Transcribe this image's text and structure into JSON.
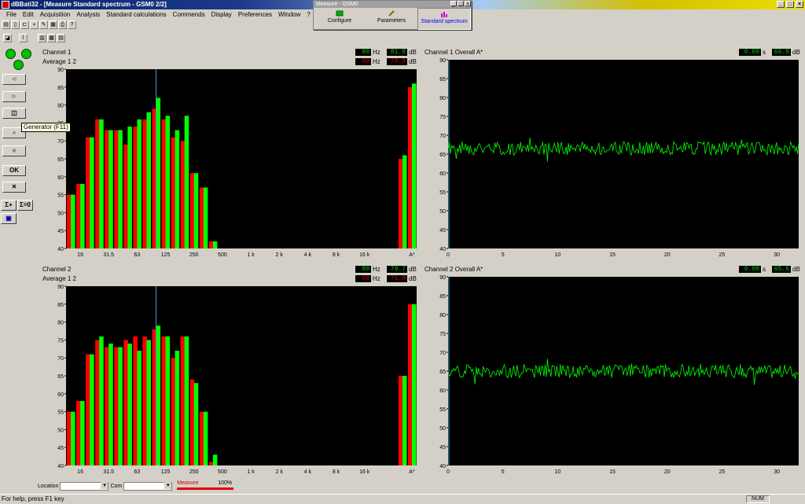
{
  "window": {
    "title": "dBBati32 - [Measure Standard spectrum - GSM0 2/2]"
  },
  "menu": [
    "File",
    "Edit",
    "Acquisition",
    "Analysis",
    "Standard calculations",
    "Commends",
    "Display",
    "Preferences",
    "Window",
    "?"
  ],
  "float_window": {
    "title": "Measure - GSM0",
    "buttons": [
      {
        "label": "Configure",
        "icon": "configure-icon"
      },
      {
        "label": "Parameters",
        "icon": "pencil-icon"
      },
      {
        "label": "Standard spectrum",
        "icon": "spectrum-icon"
      }
    ]
  },
  "left_toolbar": {
    "ok_label": "OK",
    "sigma_save_label": "Σ+",
    "sigma_zero_label": "Σ=0"
  },
  "tooltip": "Generator (F11)",
  "bottom": {
    "location_label": "Location",
    "com_label": "Com",
    "measure_label": "Measure",
    "measure_percent": "100%",
    "measure_progress": 1.0
  },
  "status": {
    "help": "For help, press F1 key",
    "num": "NUM"
  },
  "panels": [
    {
      "id": "ch1-spectrum",
      "title": "Channel 1",
      "subtitle": "Average 1 2",
      "readout1": {
        "value": "80",
        "unit": "Hz",
        "db": "81.8",
        "db_unit": "dB"
      },
      "readout2": {
        "value": "80",
        "unit": "Hz",
        "db": "78.8",
        "db_unit": "dB"
      }
    },
    {
      "id": "ch1-overall",
      "title": "Channel 1    Overall A*",
      "readout1": {
        "value": "0.00",
        "unit": "s",
        "db": "66.8",
        "db_unit": "dB"
      }
    },
    {
      "id": "ch2-spectrum",
      "title": "Channel 2",
      "subtitle": "Average 1 2",
      "readout1": {
        "value": "80",
        "unit": "Hz",
        "db": "79.7",
        "db_unit": "dB"
      },
      "readout2": {
        "value": "80",
        "unit": "Hz",
        "db": "76.8",
        "db_unit": "dB"
      }
    },
    {
      "id": "ch2-overall",
      "title": "Channel 2    Overall A*",
      "readout1": {
        "value": "0.00",
        "unit": "s",
        "db": "65.6",
        "db_unit": "dB"
      }
    }
  ],
  "chart_data": [
    {
      "type": "bar",
      "panel": "ch1-spectrum",
      "ylim": [
        40,
        90
      ],
      "yticks": [
        40,
        45,
        50,
        55,
        60,
        65,
        70,
        75,
        80,
        85,
        90
      ],
      "xtick_labels": [
        "16",
        "31.5",
        "63",
        "125",
        "250",
        "500",
        "1 k",
        "2 k",
        "4 k",
        "8 k",
        "16 k",
        "A*"
      ],
      "cursor_band": "80",
      "series": [
        {
          "name": "Average 1",
          "color": "#ff0000",
          "values": [
            55,
            58,
            71,
            76,
            73,
            73,
            69,
            74,
            76,
            79,
            76,
            71,
            70,
            61,
            57,
            42,
            null,
            null,
            null,
            null,
            null,
            null,
            null,
            null,
            null,
            null,
            null,
            null,
            null,
            null,
            null,
            null,
            null,
            null,
            null,
            65,
            85
          ]
        },
        {
          "name": "Average 2",
          "color": "#00ff00",
          "values": [
            55,
            58,
            71,
            76,
            73,
            73,
            74,
            76,
            78,
            82,
            77,
            73,
            77,
            61,
            57,
            42,
            null,
            null,
            null,
            null,
            null,
            null,
            null,
            null,
            null,
            null,
            null,
            null,
            null,
            null,
            null,
            null,
            null,
            null,
            null,
            66,
            86
          ]
        }
      ]
    },
    {
      "type": "line",
      "panel": "ch1-overall",
      "ylim": [
        40,
        90
      ],
      "yticks": [
        40,
        45,
        50,
        55,
        60,
        65,
        70,
        75,
        80,
        85,
        90
      ],
      "xlim": [
        0,
        32
      ],
      "xticks": [
        0,
        5,
        10,
        15,
        20,
        25,
        30
      ],
      "series": [
        {
          "color": "#00ff00",
          "mean": 66.5,
          "amp": 1.8,
          "seed": 1
        }
      ]
    },
    {
      "type": "bar",
      "panel": "ch2-spectrum",
      "ylim": [
        40,
        90
      ],
      "yticks": [
        40,
        45,
        50,
        55,
        60,
        65,
        70,
        75,
        80,
        85,
        90
      ],
      "xtick_labels": [
        "16",
        "31.5",
        "63",
        "125",
        "250",
        "500",
        "1 k",
        "2 k",
        "4 k",
        "8 k",
        "16 k",
        "A*"
      ],
      "cursor_band": "80",
      "series": [
        {
          "name": "Average 1",
          "color": "#ff0000",
          "values": [
            55,
            58,
            71,
            75,
            73,
            73,
            75,
            76,
            76,
            78,
            76,
            70,
            76,
            64,
            55,
            41,
            null,
            null,
            null,
            null,
            null,
            null,
            null,
            null,
            null,
            null,
            null,
            null,
            null,
            null,
            null,
            null,
            null,
            null,
            null,
            65,
            85
          ]
        },
        {
          "name": "Average 2",
          "color": "#00ff00",
          "values": [
            55,
            58,
            71,
            76,
            74,
            73,
            74,
            72,
            75,
            79,
            76,
            72,
            76,
            63,
            55,
            43,
            null,
            null,
            null,
            null,
            null,
            null,
            null,
            null,
            null,
            null,
            null,
            null,
            null,
            null,
            null,
            null,
            null,
            null,
            null,
            65,
            85
          ]
        }
      ]
    },
    {
      "type": "line",
      "panel": "ch2-overall",
      "ylim": [
        40,
        90
      ],
      "yticks": [
        40,
        45,
        50,
        55,
        60,
        65,
        70,
        75,
        80,
        85,
        90
      ],
      "xlim": [
        0,
        32
      ],
      "xticks": [
        0,
        5,
        10,
        15,
        20,
        25,
        30
      ],
      "series": [
        {
          "color": "#00ff00",
          "mean": 65,
          "amp": 1.8,
          "seed": 2
        }
      ]
    }
  ]
}
